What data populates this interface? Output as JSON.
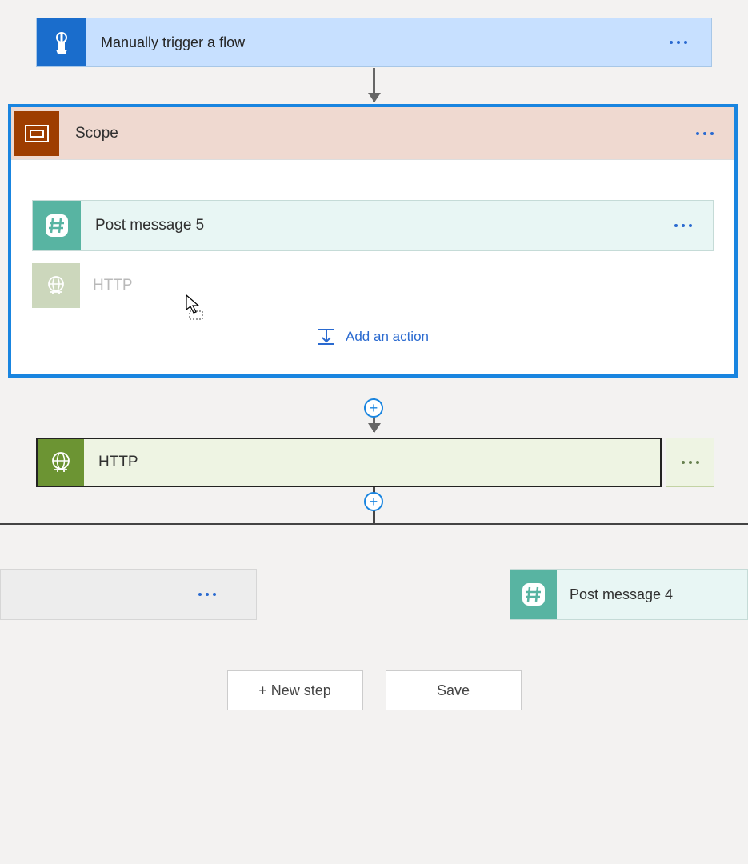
{
  "trigger": {
    "label": "Manually trigger a flow"
  },
  "scope": {
    "label": "Scope",
    "actions": [
      {
        "label": "Post message 5",
        "type": "teal"
      }
    ],
    "ghost": {
      "label": "HTTP"
    },
    "add_action_label": "Add an action"
  },
  "http": {
    "label": "HTTP"
  },
  "branches": {
    "left": {
      "label": ""
    },
    "right": {
      "label": "Post message 4"
    }
  },
  "buttons": {
    "new_step": "+ New step",
    "save": "Save"
  }
}
